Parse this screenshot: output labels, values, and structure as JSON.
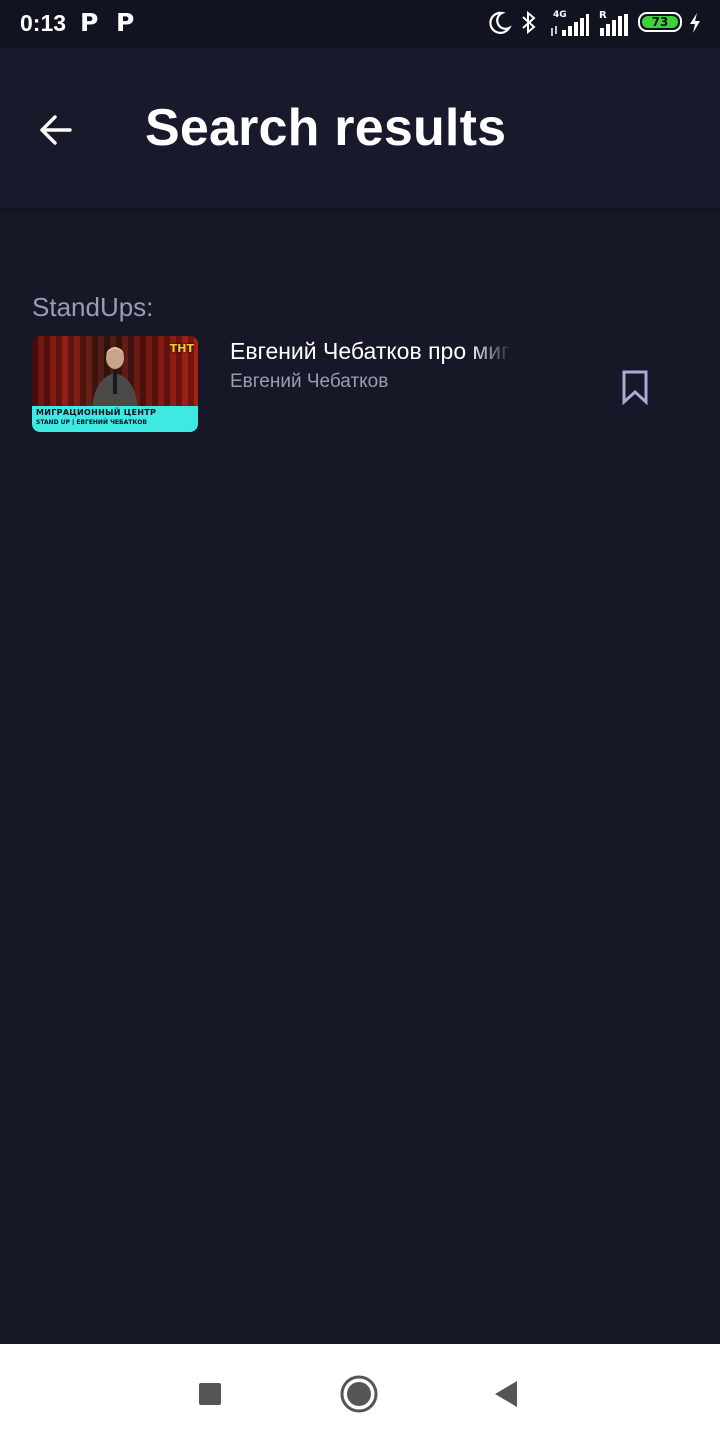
{
  "status_bar": {
    "time": "0:13",
    "notif_icons": [
      "parking-p-icon",
      "parking-p-icon"
    ],
    "p_glyph": "P",
    "network_label": "4G",
    "roaming_label": "R",
    "battery": "73",
    "icons": [
      "moon-icon",
      "bluetooth-icon",
      "signal-4g-icon",
      "signal-roaming-icon",
      "battery-icon",
      "charging-icon"
    ]
  },
  "app_bar": {
    "title": "Search results",
    "back_icon": "arrow-left-icon"
  },
  "section": {
    "label": "StandUps:"
  },
  "results": [
    {
      "title": "Евгений Чебатков про миграционный центр",
      "subtitle": "Евгений Чебатков",
      "thumb_caption": "МИГРАЦИОННЫЙ ЦЕНТР",
      "thumb_subcaption": "STAND UP | ЕВГЕНИЙ ЧЕБАТКОВ",
      "thumb_logo": "ТНТ",
      "bookmark_icon": "bookmark-icon"
    }
  ],
  "nav_bar": {
    "icons": [
      "recents-square-icon",
      "home-circle-icon",
      "back-triangle-icon"
    ]
  },
  "colors": {
    "background": "#161827",
    "app_bar": "#181a2b",
    "secondary_text": "#9a9db1",
    "accent_icon": "#a9aad6",
    "battery_green": "#3fd23c",
    "banner_cyan": "#3de9e0"
  }
}
